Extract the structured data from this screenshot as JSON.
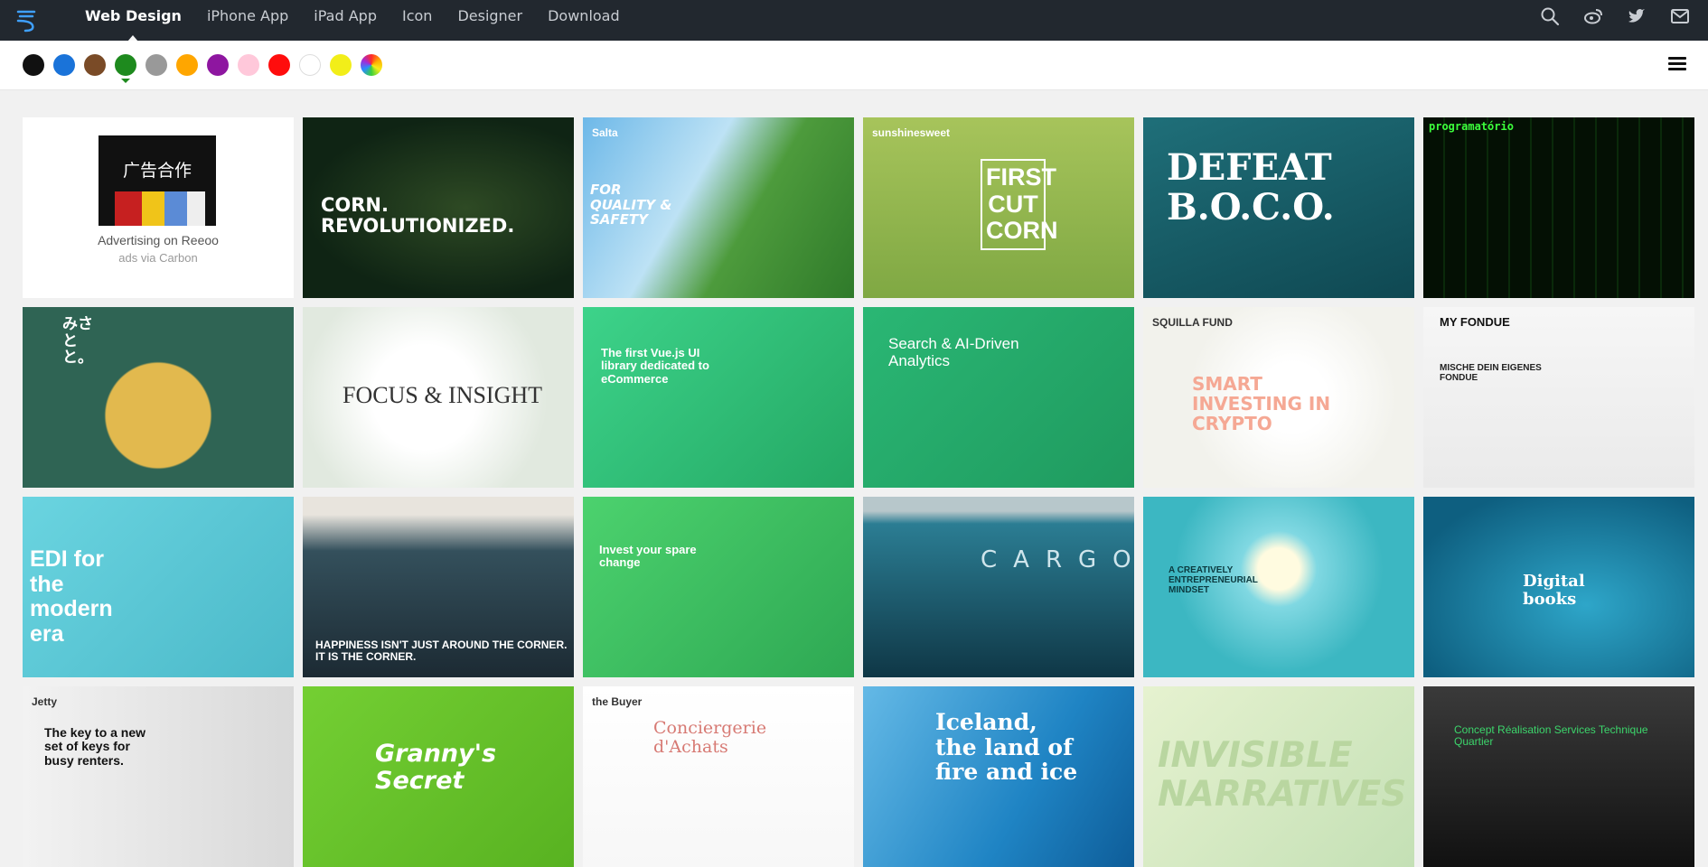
{
  "nav": {
    "items": [
      "Web Design",
      "iPhone App",
      "iPad App",
      "Icon",
      "Designer",
      "Download"
    ],
    "active_index": 0
  },
  "header_icons": [
    "search-icon",
    "weibo-icon",
    "twitter-icon",
    "mail-icon"
  ],
  "colors": {
    "swatches": [
      "#111111",
      "#1a73d9",
      "#7a4b27",
      "#1e8a1e",
      "#999999",
      "#ffa600",
      "#8e16a0",
      "#ffc8da",
      "#ff0d0d",
      "#ffffff",
      "#f2ee19",
      "rainbow"
    ],
    "selected_index": 3
  },
  "ad": {
    "image_text": "广告合作",
    "title": "Advertising on Reeoo",
    "subtitle": "ads via Carbon"
  },
  "gallery": {
    "cards": [
      {
        "headline": "CORN. REVOLUTIONIZED.",
        "bg": "#0f2414"
      },
      {
        "headline": "FOR QUALITY & SAFETY",
        "brand": "Salta",
        "bg": "#4a8f3a"
      },
      {
        "headline": "FIRST CUT CORN",
        "brand": "sunshinesweet",
        "bg": "#8db34a"
      },
      {
        "headline": "DEFEAT B.O.C.O.",
        "bg": "#17585f"
      },
      {
        "headline": "programatório",
        "bg": "#050505"
      },
      {
        "headline": "みさとと。",
        "bg": "#2f6454"
      },
      {
        "headline": "FOCUS & INSIGHT",
        "bg": "#eef2ec"
      },
      {
        "headline": "The first Vue.js UI library dedicated to eCommerce",
        "bg": "#35c07a"
      },
      {
        "headline": "Search & AI-Driven Analytics",
        "bg": "#25a96b"
      },
      {
        "headline": "SMART INVESTING IN CRYPTO",
        "brand": "SQUILLA FUND",
        "bg": "#f4f4f0"
      },
      {
        "headline": "MY FONDUE",
        "sub": "MISCHE DEIN EIGENES FONDUE",
        "bg": "#f3f3f3"
      },
      {
        "headline": "EDI for the modern era",
        "bg": "#5bc9d7"
      },
      {
        "headline": "HAPPINESS ISN'T JUST AROUND THE CORNER. IT IS THE CORNER.",
        "bg": "#1c2a33"
      },
      {
        "headline": "Invest your spare change",
        "bg": "#3cbd61"
      },
      {
        "headline": "CARGO",
        "bg": "#1a4f63"
      },
      {
        "headline": "A CREATIVELY ENTREPRENEURIAL MINDSET",
        "bg": "#3cb7c2"
      },
      {
        "headline": "Digital books",
        "bg": "#1b7ea3"
      },
      {
        "headline": "The key to a new set of keys for busy renters.",
        "brand": "Jetty",
        "bg": "#e8e8e8"
      },
      {
        "headline": "Granny's Secret",
        "bg": "#6ac12b"
      },
      {
        "headline": "Conciergerie d'Achats",
        "brand": "the Buyer",
        "bg": "#ffffff"
      },
      {
        "headline": "Iceland, the land of fire and ice",
        "bg": "#1f84c4"
      },
      {
        "headline": "INVISIBLE NARRATIVES",
        "bg": "#d8ecc0"
      },
      {
        "headline": "Concept Réalisation Services Technique Quartier",
        "bg": "#1a1a1a"
      }
    ]
  }
}
